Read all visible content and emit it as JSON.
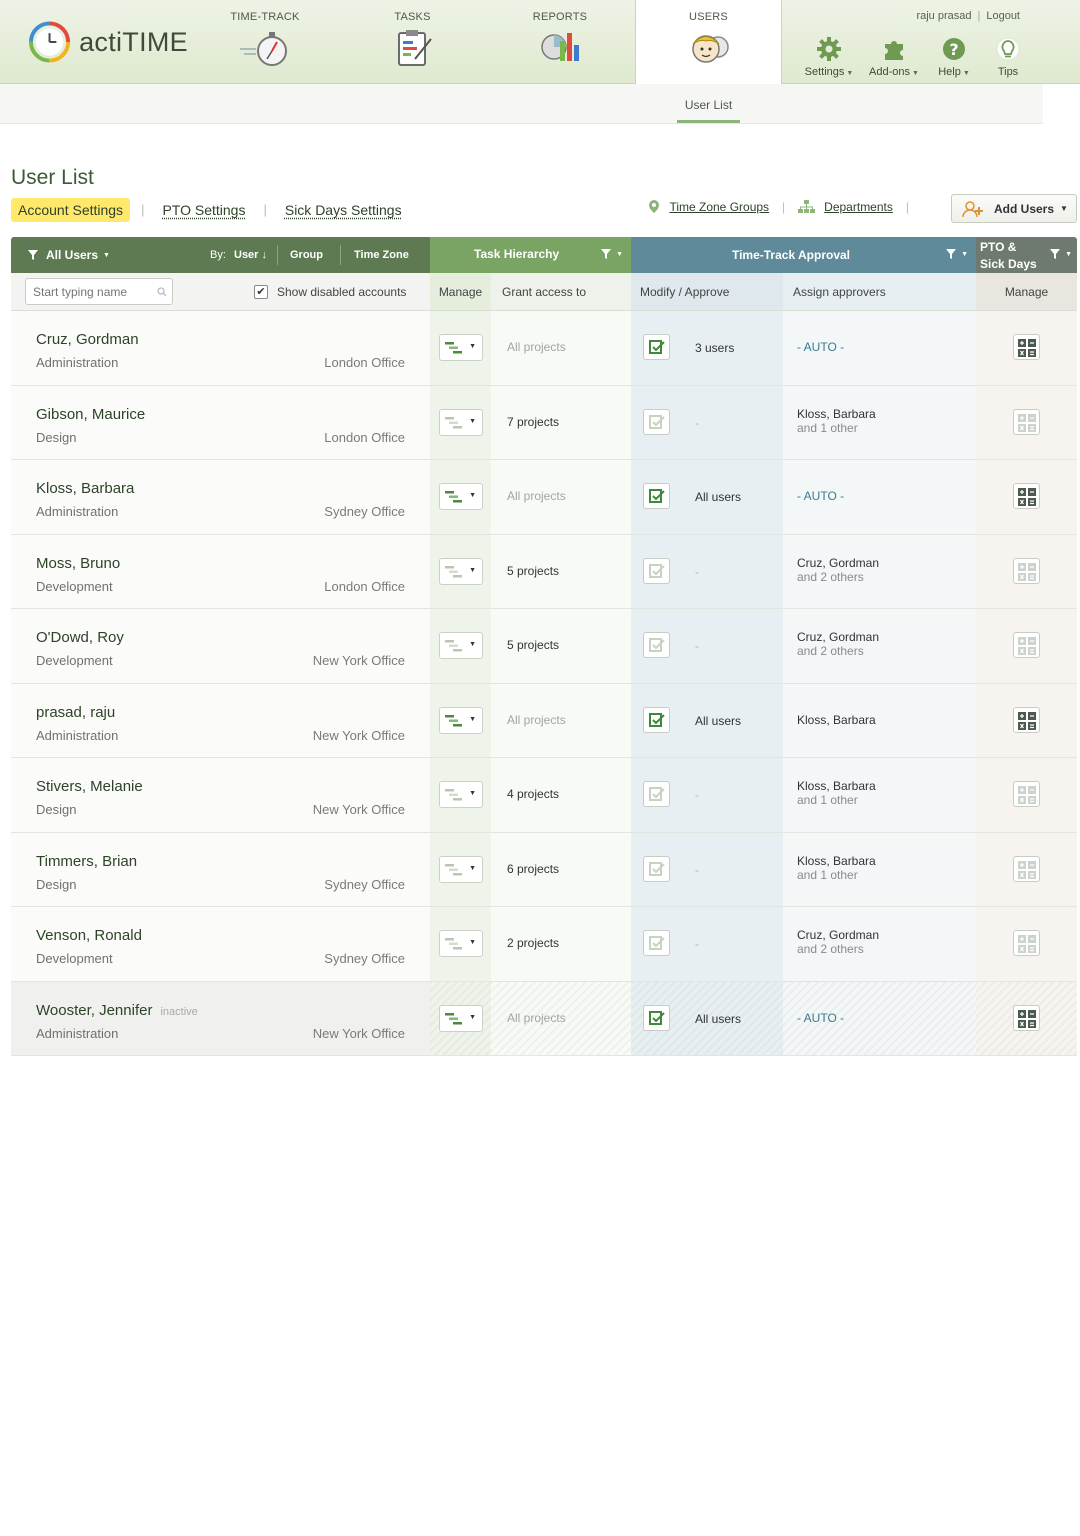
{
  "app": {
    "logo_text": "actiTIME",
    "nav": {
      "timetrack": "TIME-TRACK",
      "tasks": "TASKS",
      "reports": "REPORTS",
      "users": "USERS"
    },
    "user_name": "raju prasad",
    "logout": "Logout",
    "tools": {
      "settings": "Settings",
      "addons": "Add-ons",
      "help": "Help",
      "tips": "Tips"
    },
    "subnav": {
      "user_list": "User List"
    }
  },
  "page": {
    "title": "User List",
    "tabs": [
      "Account Settings",
      "PTO Settings",
      "Sick Days Settings"
    ],
    "links": {
      "tz_groups": "Time Zone Groups",
      "departments": "Departments"
    },
    "add_users": "Add Users"
  },
  "table": {
    "headers": {
      "users_filter": "All Users",
      "by": "By:",
      "by_user": "User",
      "by_group": "Group",
      "by_tz": "Time Zone",
      "task_hierarchy": "Task  Hierarchy",
      "tt_approval": "Time-Track Approval",
      "pto_line1": "PTO &",
      "pto_line2": "Sick Days"
    },
    "subheaders": {
      "search_placeholder": "Start typing name",
      "show_disabled": "Show disabled accounts",
      "manage": "Manage",
      "grant_access": "Grant access to",
      "modify_approve": "Modify / Approve",
      "assign_approvers": "Assign approvers",
      "pto_manage": "Manage"
    },
    "rows": [
      {
        "name": "Cruz, Gordman",
        "dept": "Administration",
        "office": "London Office",
        "grant": "All projects",
        "grant_dim": true,
        "mod_active": true,
        "modify": "3 users",
        "assign": "- AUTO -",
        "assign_sub": "",
        "auto": true,
        "pto_active": true,
        "inactive": ""
      },
      {
        "name": "Gibson, Maurice",
        "dept": "Design",
        "office": "London Office",
        "grant": "7 projects",
        "grant_dim": false,
        "mod_active": false,
        "modify": "-",
        "assign": "Kloss, Barbara",
        "assign_sub": "and 1 other",
        "auto": false,
        "pto_active": false,
        "inactive": ""
      },
      {
        "name": "Kloss, Barbara",
        "dept": "Administration",
        "office": "Sydney Office",
        "grant": "All projects",
        "grant_dim": true,
        "mod_active": true,
        "modify": "All users",
        "assign": "- AUTO -",
        "assign_sub": "",
        "auto": true,
        "pto_active": true,
        "inactive": ""
      },
      {
        "name": "Moss, Bruno",
        "dept": "Development",
        "office": "London Office",
        "grant": "5 projects",
        "grant_dim": false,
        "mod_active": false,
        "modify": "-",
        "assign": "Cruz, Gordman",
        "assign_sub": "and 2 others",
        "auto": false,
        "pto_active": false,
        "inactive": ""
      },
      {
        "name": "O'Dowd, Roy",
        "dept": "Development",
        "office": "New York Office",
        "grant": "5 projects",
        "grant_dim": false,
        "mod_active": false,
        "modify": "-",
        "assign": "Cruz, Gordman",
        "assign_sub": "and 2 others",
        "auto": false,
        "pto_active": false,
        "inactive": ""
      },
      {
        "name": "prasad, raju",
        "dept": "Administration",
        "office": "New York Office",
        "grant": "All projects",
        "grant_dim": true,
        "mod_active": true,
        "modify": "All users",
        "assign": "Kloss, Barbara",
        "assign_sub": "",
        "auto": false,
        "pto_active": true,
        "inactive": ""
      },
      {
        "name": "Stivers, Melanie",
        "dept": "Design",
        "office": "New York Office",
        "grant": "4 projects",
        "grant_dim": false,
        "mod_active": false,
        "modify": "-",
        "assign": "Kloss, Barbara",
        "assign_sub": "and 1 other",
        "auto": false,
        "pto_active": false,
        "inactive": ""
      },
      {
        "name": "Timmers, Brian",
        "dept": "Design",
        "office": "Sydney Office",
        "grant": "6 projects",
        "grant_dim": false,
        "mod_active": false,
        "modify": "-",
        "assign": "Kloss, Barbara",
        "assign_sub": "and 1 other",
        "auto": false,
        "pto_active": false,
        "inactive": ""
      },
      {
        "name": "Venson, Ronald",
        "dept": "Development",
        "office": "Sydney Office",
        "grant": "2 projects",
        "grant_dim": false,
        "mod_active": false,
        "modify": "-",
        "assign": "Cruz, Gordman",
        "assign_sub": "and 2 others",
        "auto": false,
        "pto_active": false,
        "inactive": ""
      },
      {
        "name": "Wooster, Jennifer",
        "dept": "Administration",
        "office": "New York Office",
        "grant": "All projects",
        "grant_dim": true,
        "mod_active": true,
        "modify": "All users",
        "assign": "- AUTO -",
        "assign_sub": "",
        "auto": true,
        "pto_active": true,
        "inactive": "inactive"
      }
    ]
  },
  "colors": {
    "accent_green": "#79a463",
    "dark_green": "#5e7a52",
    "approval_blue": "#5f8a9a",
    "highlight_yellow": "#ffe86a"
  },
  "icons": [
    "logo-clock-icon",
    "stopwatch-icon",
    "clipboard-icon",
    "report-chart-icon",
    "users-avatar-icon",
    "gear-icon",
    "puzzle-icon",
    "question-icon",
    "lightbulb-icon",
    "location-pin-icon",
    "org-chart-icon",
    "add-user-icon",
    "filter-icon",
    "search-icon",
    "hierarchy-icon",
    "approve-check-icon",
    "pto-calculator-icon"
  ]
}
